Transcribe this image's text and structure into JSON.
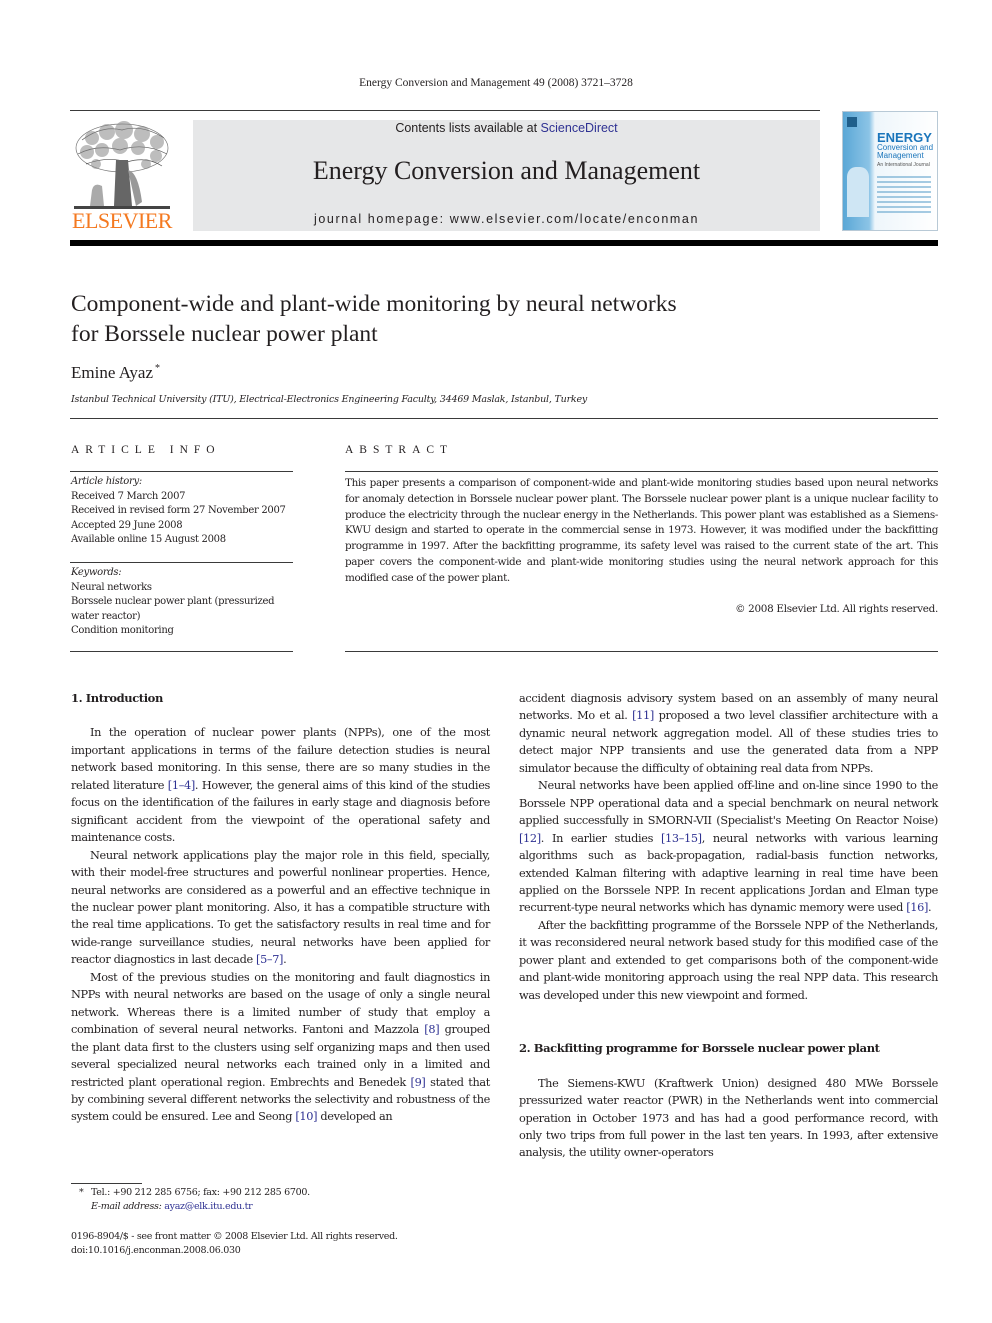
{
  "running_head": "Energy Conversion and Management 49 (2008) 3721–3728",
  "masthead": {
    "publisher_logo_text": "ELSEVIER",
    "contents_prefix": "Contents lists available at ",
    "contents_link": "ScienceDirect",
    "journal_title": "Energy Conversion and Management",
    "homepage": "journal homepage: www.elsevier.com/locate/enconman",
    "cover": {
      "title": "ENERGY",
      "subtitle_1": "Conversion and",
      "subtitle_2": "Management",
      "tagline": "An International Journal"
    }
  },
  "colors": {
    "elsevier_orange": "#f47920",
    "link_blue": "#2e3192",
    "masthead_gray": "#e6e7e8"
  },
  "article": {
    "title_line1": "Component-wide and plant-wide monitoring by neural networks",
    "title_line2": "for Borssele nuclear power plant",
    "author": "Emine Ayaz",
    "author_mark": "*",
    "affiliation": "Istanbul Technical University (ITU), Electrical-Electronics Engineering Faculty, 34469 Maslak, Istanbul, Turkey"
  },
  "article_info": {
    "heading": "ARTICLE INFO",
    "history_label": "Article history:",
    "history": [
      "Received 7 March 2007",
      "Received in revised form 27 November 2007",
      "Accepted 29 June 2008",
      "Available online 15 August 2008"
    ],
    "keywords_label": "Keywords:",
    "keywords": [
      "Neural networks",
      "Borssele nuclear power plant (pressurized water reactor)",
      "Condition monitoring"
    ]
  },
  "abstract": {
    "heading": "ABSTRACT",
    "text": "This paper presents a comparison of component-wide and plant-wide monitoring studies based upon neural networks for anomaly detection in Borssele nuclear power plant. The Borssele nuclear power plant is a unique nuclear facility to produce the electricity through the nuclear energy in the Netherlands. This power plant was established as a Siemens-KWU design and started to operate in the commercial sense in 1973. However, it was modified under the backfitting programme in 1997. After the backfitting programme, its safety level was raised to the current state of the art. This paper covers the component-wide and plant-wide monitoring studies using the neural network approach for this modified case of the power plant.",
    "copyright": "© 2008 Elsevier Ltd. All rights reserved."
  },
  "body": {
    "section1_title": "1. Introduction",
    "p1": {
      "a": "In the operation of nuclear power plants (NPPs), one of the most important applications in terms of the failure detection studies is neural network based monitoring. In this sense, there are so many studies in the related literature ",
      "ref": "[1–4]",
      "b": ". However, the general aims of this kind of the studies focus on the identification of the failures in early stage and diagnosis before significant accident from the viewpoint of the operational safety and maintenance costs."
    },
    "p2": {
      "a": "Neural network applications play the major role in this field, specially, with their model-free structures and powerful nonlinear properties. Hence, neural networks are considered as a powerful and an effective technique in the nuclear power plant monitoring. Also, it has a compatible structure with the real time applications. To get the satisfactory results in real time and for wide-range surveillance studies, neural networks have been applied for reactor diagnostics in last decade ",
      "ref": "[5–7]",
      "b": "."
    },
    "p3": {
      "a": "Most of the previous studies on the monitoring and fault diagnostics in NPPs with neural networks are based on the usage of only a single neural network. Whereas there is a limited number of study that employ a combination of several neural networks. Fantoni and Mazzola ",
      "ref1": "[8]",
      "b": " grouped the plant data first to the clusters using self organizing maps and then used several specialized neural networks each trained only in a limited and restricted plant operational region. Embrechts and Benedek ",
      "ref2": "[9]",
      "c": " stated that by combining several different networks the selectivity and robustness of the system could be ensured. Lee and Seong ",
      "ref3": "[10]",
      "d": " developed an accident diagnosis advisory system based on an assembly of many neural networks. Mo et al. ",
      "ref4": "[11]",
      "e": " proposed a two level classifier architecture with a dynamic neural network aggregation model. All of these studies tries to detect major NPP transients and use the generated data from a NPP simulator because the difficulty of obtaining real data from NPPs."
    },
    "p4": {
      "a": "Neural networks have been applied off-line and on-line since 1990 to the Borssele NPP operational data and a special benchmark on neural network applied successfully in SMORN-VII (Specialist's Meeting On Reactor Noise) ",
      "ref1": "[12]",
      "b": ". In earlier studies ",
      "ref2": "[13–15]",
      "c": ", neural networks with various learning algorithms such as back-propagation, radial-basis function networks, extended Kalman filtering with adaptive learning in real time have been applied on the Borssele NPP. In recent applications Jordan and Elman type recurrent-type neural networks which has dynamic memory were used ",
      "ref3": "[16]",
      "d": "."
    },
    "p5": "After the backfitting programme of the Borssele NPP of the Netherlands, it was reconsidered neural network based study for this modified case of the power plant and extended to get comparisons both of the component-wide and plant-wide monitoring approach using the real NPP data. This research was developed under this new viewpoint and formed.",
    "section2_title": "2. Backfitting programme for Borssele nuclear power plant",
    "p6": "The Siemens-KWU (Kraftwerk Union) designed 480 MWe Borssele pressurized water reactor (PWR) in the Netherlands went into commercial operation in October 1973 and has had a good performance record, with only two trips from full power in the last ten years. In 1993, after extensive analysis, the utility owner-operators"
  },
  "footnote": {
    "mark": "*",
    "contact": "Tel.: +90 212 285 6756; fax: +90 212 285 6700.",
    "email_label": "E-mail address:",
    "email": "ayaz@elk.itu.edu.tr"
  },
  "issn_line": "0196-8904/$ - see front matter © 2008 Elsevier Ltd. All rights reserved.",
  "doi": "doi:10.1016/j.enconman.2008.06.030"
}
